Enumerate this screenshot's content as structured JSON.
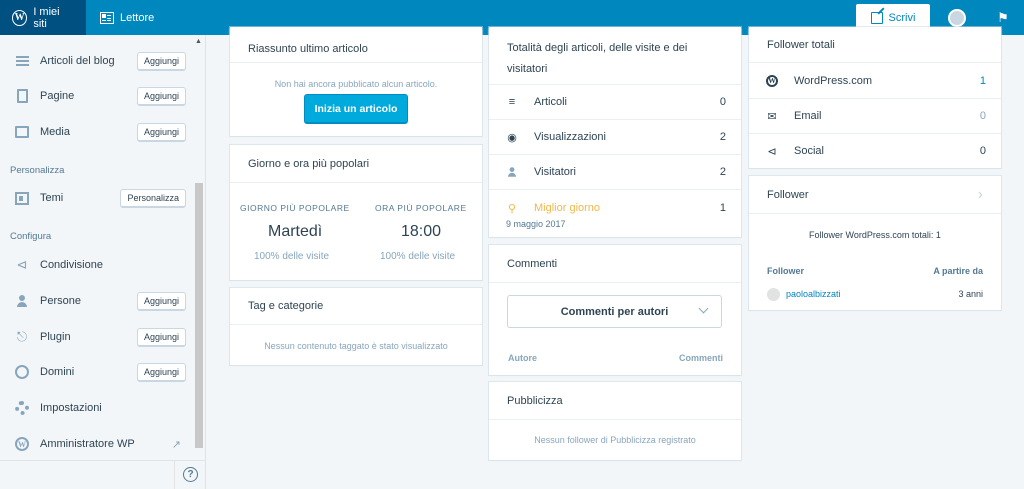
{
  "masterbar": {
    "my_sites": "I miei siti",
    "reader": "Lettore",
    "write": "Scrivi"
  },
  "sidebar": {
    "items": [
      {
        "label": "Articoli del blog",
        "button": "Aggiungi"
      },
      {
        "label": "Pagine",
        "button": "Aggiungi"
      },
      {
        "label": "Media",
        "button": "Aggiungi"
      }
    ],
    "heading_personalize": "Personalizza",
    "themes": {
      "label": "Temi",
      "button": "Personalizza"
    },
    "heading_configure": "Configura",
    "config_items": [
      {
        "label": "Condivisione"
      },
      {
        "label": "Persone",
        "button": "Aggiungi"
      },
      {
        "label": "Plugin",
        "button": "Aggiungi"
      },
      {
        "label": "Domini",
        "button": "Aggiungi"
      },
      {
        "label": "Impostazioni"
      },
      {
        "label": "Amministratore WP"
      }
    ]
  },
  "latest_post": {
    "title": "Riassunto ultimo articolo",
    "empty": "Non hai ancora pubblicato alcun articolo.",
    "button": "Inizia un articolo"
  },
  "popular": {
    "title": "Giorno e ora più popolari",
    "day_head": "GIORNO PIÙ POPOLARE",
    "day_value": "Martedì",
    "day_sub": "100% delle visite",
    "hour_head": "ORA PIÙ POPOLARE",
    "hour_value": "18:00",
    "hour_sub": "100% delle visite"
  },
  "tags": {
    "title": "Tag e categorie",
    "empty": "Nessun contenuto taggato è stato visualizzato"
  },
  "totals": {
    "title_line1": "Totalità degli articoli, delle visite e dei",
    "title_line2": "visitatori",
    "rows": [
      {
        "label": "Articoli",
        "value": "0",
        "icon": "posts-icon"
      },
      {
        "label": "Visualizzazioni",
        "value": "2",
        "icon": "eye-icon"
      },
      {
        "label": "Visitatori",
        "value": "2",
        "icon": "person-icon"
      }
    ],
    "best_day": {
      "label": "Miglior giorno",
      "value": "1",
      "date": "9 maggio 2017",
      "color": "#f0b849"
    }
  },
  "comments": {
    "title": "Commenti",
    "select": "Commenti per autori",
    "col_author": "Autore",
    "col_comments": "Commenti"
  },
  "publicize": {
    "title": "Pubblicizza",
    "empty": "Nessun follower di Pubblicizza registrato"
  },
  "followers_total": {
    "title": "Follower totali",
    "rows": [
      {
        "label": "WordPress.com",
        "value": "1",
        "highlight": true
      },
      {
        "label": "Email",
        "value": "0"
      },
      {
        "label": "Social",
        "value": "0"
      }
    ]
  },
  "followers": {
    "title": "Follower",
    "total": "Follower WordPress.com totali: 1",
    "col_follower": "Follower",
    "col_since": "A partire da",
    "rows": [
      {
        "name": "paoloalbizzati",
        "since": "3 anni"
      }
    ]
  }
}
